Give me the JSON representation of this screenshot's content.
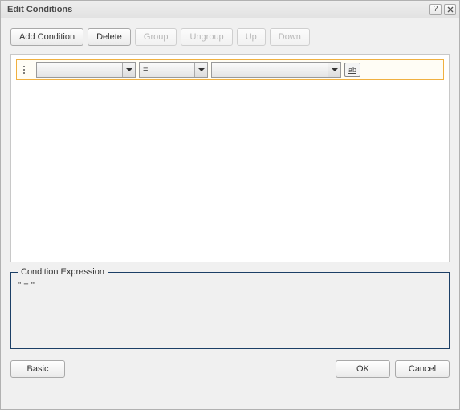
{
  "window": {
    "title": "Edit Conditions"
  },
  "toolbar": {
    "add": "Add Condition",
    "delete": "Delete",
    "group": "Group",
    "ungroup": "Ungroup",
    "up": "Up",
    "down": "Down"
  },
  "condition_rows": [
    {
      "field": "",
      "operator": "=",
      "value": ""
    }
  ],
  "expression_panel": {
    "legend": "Condition Expression",
    "text": "'' = ''"
  },
  "footer": {
    "basic": "Basic",
    "ok": "OK",
    "cancel": "Cancel"
  },
  "icons": {
    "text_toggle": "ab"
  }
}
